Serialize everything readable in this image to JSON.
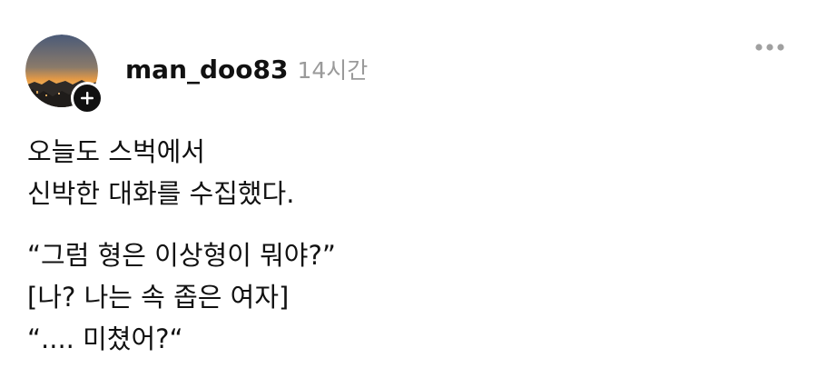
{
  "post": {
    "username": "man_doo83",
    "timestamp": "14시간",
    "avatar_icon": "sunset-skyline-avatar",
    "follow_icon": "plus-icon",
    "more_icon": "more-horizontal-icon",
    "paragraphs": [
      [
        "오늘도 스벅에서",
        "신박한 대화를 수집했다."
      ],
      [
        "“그럼 형은 이상형이 뭐야?”",
        "[나? 나는 속 좁은 여자]",
        "“.... 미쳤어?“"
      ]
    ]
  }
}
